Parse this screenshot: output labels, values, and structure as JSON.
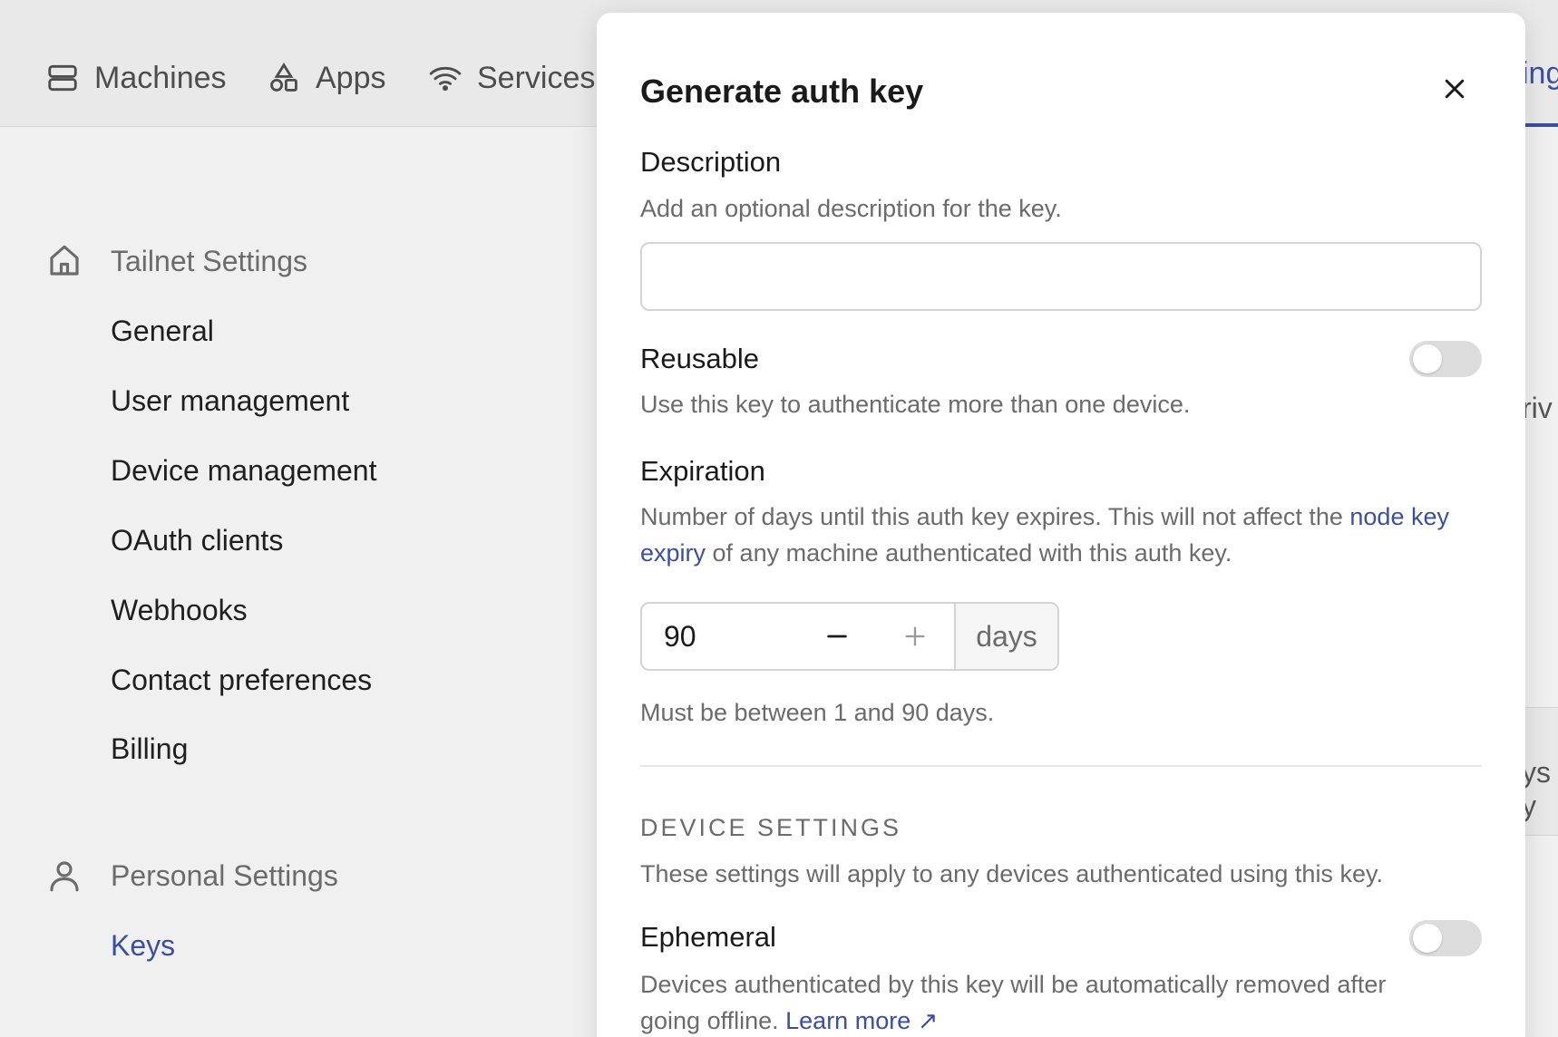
{
  "topnav": {
    "items": [
      {
        "label": "Machines",
        "icon": "server-icon"
      },
      {
        "label": "Apps",
        "icon": "shapes-icon"
      },
      {
        "label": "Services",
        "icon": "wifi-icon"
      }
    ],
    "clipped_label": "ing"
  },
  "sidebar": {
    "tailnet_group": "Tailnet Settings",
    "tailnet_items": [
      "General",
      "User management",
      "Device management",
      "OAuth clients",
      "Webhooks",
      "Contact preferences",
      "Billing"
    ],
    "personal_group": "Personal Settings",
    "personal_items": [
      "Keys"
    ]
  },
  "background_fragments": {
    "priv": "riv",
    "ys": "ys y"
  },
  "dialog": {
    "title": "Generate auth key",
    "description": {
      "label": "Description",
      "hint": "Add an optional description for the key.",
      "value": "",
      "placeholder": ""
    },
    "reusable": {
      "label": "Reusable",
      "hint": "Use this key to authenticate more than one device.",
      "enabled": false
    },
    "expiration": {
      "label": "Expiration",
      "hint_before": "Number of days until this auth key expires. This will not affect the ",
      "hint_link": "node key expiry",
      "hint_after": " of any machine authenticated with this auth key.",
      "value": "90",
      "unit": "days",
      "constraint": "Must be between 1 and 90 days."
    },
    "device_settings": {
      "title": "DEVICE SETTINGS",
      "hint": "These settings will apply to any devices authenticated using this key."
    },
    "ephemeral": {
      "label": "Ephemeral",
      "hint_before": "Devices authenticated by this key will be automatically removed after going offline. ",
      "link": "Learn more ↗",
      "enabled": false
    }
  },
  "colors": {
    "accent": "#3b4ea0",
    "toggle_off": "#dcdcdc",
    "muted_text": "#6b6b6b"
  }
}
